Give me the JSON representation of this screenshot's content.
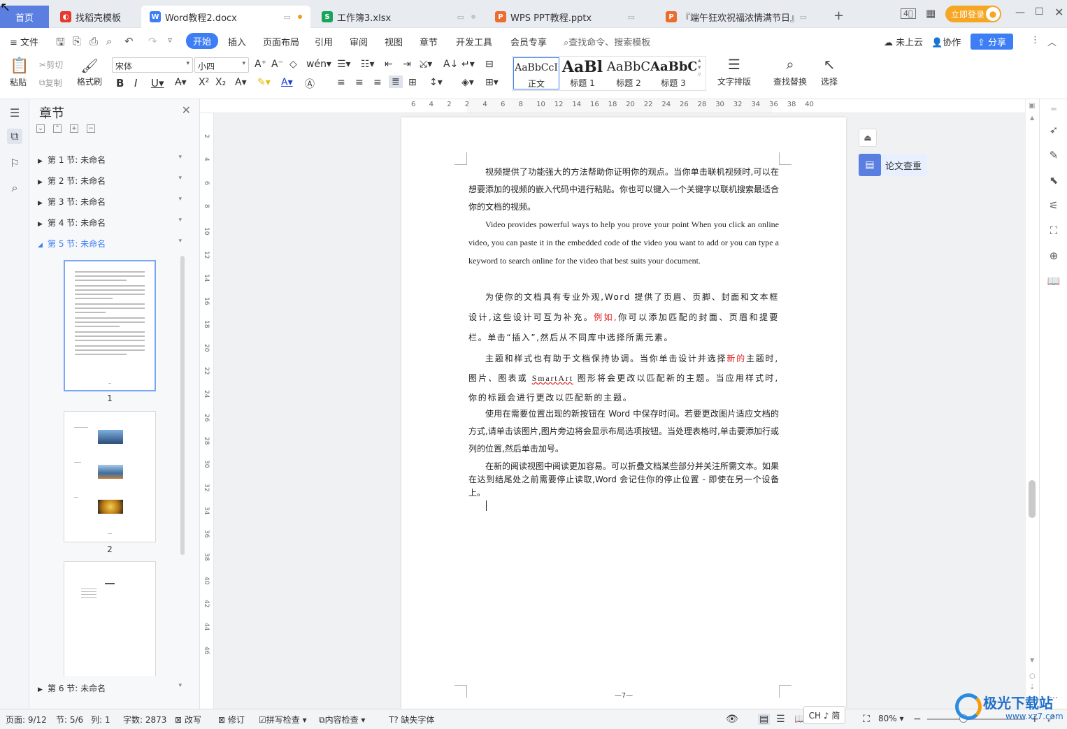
{
  "tabs": [
    {
      "label": "首页"
    },
    {
      "label": "找稻壳模板",
      "icon": "daoke-icon",
      "icon_color": "#e63a2e"
    },
    {
      "label": "Word教程2.docx",
      "icon": "word-icon",
      "icon_color": "#3d7ef5"
    },
    {
      "label": "工作簿3.xlsx",
      "icon": "excel-icon",
      "icon_color": "#1aa35b"
    },
    {
      "label": "WPS PPT教程.pptx",
      "icon": "ppt-icon",
      "icon_color": "#ec6b2d"
    },
    {
      "label": "『端午狂欢祝福浓情满节日』",
      "icon": "ppt-icon",
      "icon_color": "#ec6b2d"
    }
  ],
  "login": {
    "label": "立即登录"
  },
  "menu": {
    "file": "文件",
    "items": [
      "开始",
      "插入",
      "页面布局",
      "引用",
      "审阅",
      "视图",
      "章节",
      "开发工具",
      "会员专享"
    ],
    "search": "查找命令、搜索模板",
    "cloud": "未上云",
    "collab": "协作",
    "share": "分享"
  },
  "toolbar": {
    "paste": "粘贴",
    "cut": "剪切",
    "copy": "复制",
    "format_painter": "格式刷",
    "font": "宋体",
    "size": "小四",
    "text_layout": "文字排版",
    "find_replace": "查找替换",
    "select": "选择"
  },
  "styles": [
    {
      "preview": "AaBbCcI",
      "name": "正文"
    },
    {
      "preview": "AaBl",
      "name": "标题 1"
    },
    {
      "preview": "AaBbC",
      "name": "标题 2"
    },
    {
      "preview": "AaBbC",
      "name": "标题 3"
    }
  ],
  "nav": {
    "title": "章节",
    "sections": [
      "第 1 节: 未命名",
      "第 2 节: 未命名",
      "第 3 节: 未命名",
      "第 4 节: 未命名",
      "第 5 节: 未命名",
      "第 6 节: 未命名"
    ],
    "active_section": 5,
    "thumb_numbers": [
      "1",
      "2"
    ]
  },
  "ruler": {
    "h": [
      "6",
      "4",
      "2",
      "2",
      "4",
      "6",
      "8",
      "10",
      "12",
      "14",
      "16",
      "18",
      "20",
      "22",
      "24",
      "26",
      "28",
      "30",
      "32",
      "34",
      "36",
      "38",
      "40"
    ],
    "v": [
      "2",
      "4",
      "6",
      "8",
      "10",
      "12",
      "14",
      "16",
      "18",
      "20",
      "22",
      "24",
      "26",
      "28",
      "30",
      "32",
      "34",
      "36",
      "38",
      "40",
      "42",
      "44",
      "46"
    ]
  },
  "document": {
    "p1": "视频提供了功能强大的方法帮助你证明你的观点。当你单击联机视频时,可以在想要添加的视频的嵌入代码中进行粘贴。你也可以键入一个关键字以联机搜索最适合你的文档的视频。",
    "p2": "Video provides powerful ways to help you prove your point When you click an online video, you can paste it in the embedded code of the video you want to add or you can type a keyword to search online for the video that best suits your document.",
    "p3a": "为使你的文档具有专业外观,Word 提供了页眉、页脚、封面和文本框设计,这些设计可互为补充。",
    "p3b": "例如,",
    "p3c": "你可以添加匹配的封面、页眉和提要栏。单击“插入”,然后从不同库中选择所需元素。",
    "p4a": "主题和样式也有助于文档保持协调。当你单击设计并选择",
    "p4b": "新的",
    "p4c": "主题时,图片、图表或 ",
    "p4d": "SmartArt",
    "p4e": " 图形将会更改以匹配新的主题。当应用样式时,你的标题会进行更改以匹配新的主题。",
    "p5": "使用在需要位置出现的新按钮在 Word 中保存时间。若要更改图片适应文档的方式,请单击该图片,图片旁边将会显示布局选项按钮。当处理表格时,单击要添加行或列的位置,然后单击加号。",
    "p6": "在新的阅读视图中阅读更加容易。可以折叠文档某些部分并关注所需文本。如果在达到结尾处之前需要停止读取,Word 会记住你的停止位置 - 即使在另一个设备上。",
    "footer": "—7—"
  },
  "side": {
    "paper_check": "论文查重"
  },
  "status": {
    "page": "页面: 9/12",
    "section": "节: 5/6",
    "col": "列: 1",
    "words": "字数: 2873",
    "rewrite": "改写",
    "revise": "修订",
    "spell": "拼写检查",
    "content": "内容检查",
    "missing_font": "缺失字体",
    "ime": "CH ♪ 简",
    "zoom": "80%"
  },
  "watermark": {
    "name": "极光下载站",
    "url": "www.xz7.com"
  }
}
